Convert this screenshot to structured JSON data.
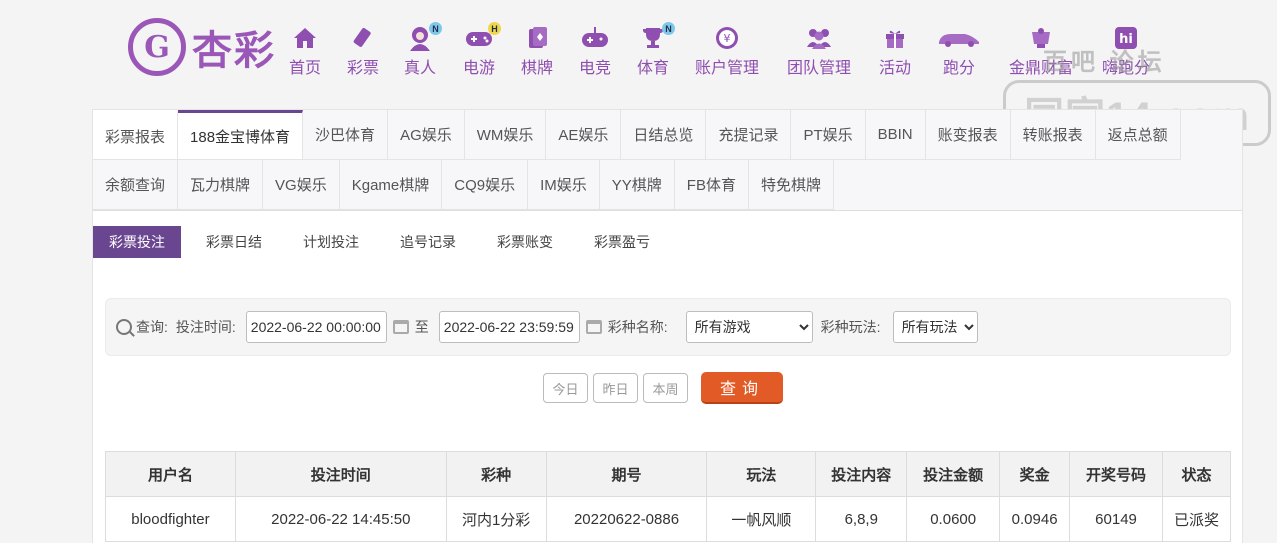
{
  "brand": {
    "logo_letter": "G",
    "name": "杏彩"
  },
  "nav": [
    {
      "label": "首页",
      "icon": "home-icon",
      "badge": ""
    },
    {
      "label": "彩票",
      "icon": "lottery-ticket-icon",
      "badge": ""
    },
    {
      "label": "真人",
      "icon": "live-dealer-icon",
      "badge": "N"
    },
    {
      "label": "电游",
      "icon": "gamepad-icon",
      "badge": "H"
    },
    {
      "label": "棋牌",
      "icon": "cards-icon",
      "badge": ""
    },
    {
      "label": "电竞",
      "icon": "esports-controller-icon",
      "badge": ""
    },
    {
      "label": "体育",
      "icon": "trophy-icon",
      "badge": "N"
    },
    {
      "label": "账户管理",
      "icon": "yen-coin-icon",
      "badge": ""
    },
    {
      "label": "团队管理",
      "icon": "team-icon",
      "badge": ""
    },
    {
      "label": "活动",
      "icon": "gift-icon",
      "badge": ""
    },
    {
      "label": "跑分",
      "icon": "car-icon",
      "badge": ""
    },
    {
      "label": "金鼎财富",
      "icon": "treasure-icon",
      "badge": ""
    },
    {
      "label": "嗨跑分",
      "icon": "hi-app-icon",
      "badge": ""
    }
  ],
  "watermark": {
    "top": "百吧  论坛",
    "main": "同家14.com"
  },
  "tabs_row1": [
    "彩票报表",
    "188金宝博体育",
    "沙巴体育",
    "AG娱乐",
    "WM娱乐",
    "AE娱乐",
    "日结总览",
    "充提记录",
    "PT娱乐",
    "BBIN",
    "账变报表",
    "转账报表",
    "返点总额"
  ],
  "tabs_row2": [
    "余额查询",
    "瓦力棋牌",
    "VG娱乐",
    "Kgame棋牌",
    "CQ9娱乐",
    "IM娱乐",
    "YY棋牌",
    "FB体育",
    "特免棋牌"
  ],
  "subtabs": [
    "彩票投注",
    "彩票日结",
    "计划投注",
    "追号记录",
    "彩票账变",
    "彩票盈亏"
  ],
  "query": {
    "search_label": "查询:",
    "time_label": "投注时间:",
    "start_time": "2022-06-22 00:00:00",
    "to_label": "至",
    "end_time": "2022-06-22 23:59:59",
    "game_label": "彩种名称:",
    "game_value": "所有游戏",
    "play_label": "彩种玩法:",
    "play_value": "所有玩法"
  },
  "quick_buttons": {
    "today": "今日",
    "yesterday": "昨日",
    "week": "本周",
    "search": "查询"
  },
  "table": {
    "headers": [
      "用户名",
      "投注时间",
      "彩种",
      "期号",
      "玩法",
      "投注内容",
      "投注金额",
      "奖金",
      "开奖号码",
      "状态"
    ],
    "rows": [
      [
        "bloodfighter",
        "2022-06-22 14:45:50",
        "河内1分彩",
        "20220622-0886",
        "一帆风顺",
        "6,8,9",
        "0.0600",
        "0.0946",
        "60149",
        "已派奖"
      ]
    ]
  },
  "colors": {
    "brand": "#8f4fb0",
    "active_tab": "#6a4690",
    "search_button": "#e25a26",
    "status_paid": "#e07a18"
  }
}
